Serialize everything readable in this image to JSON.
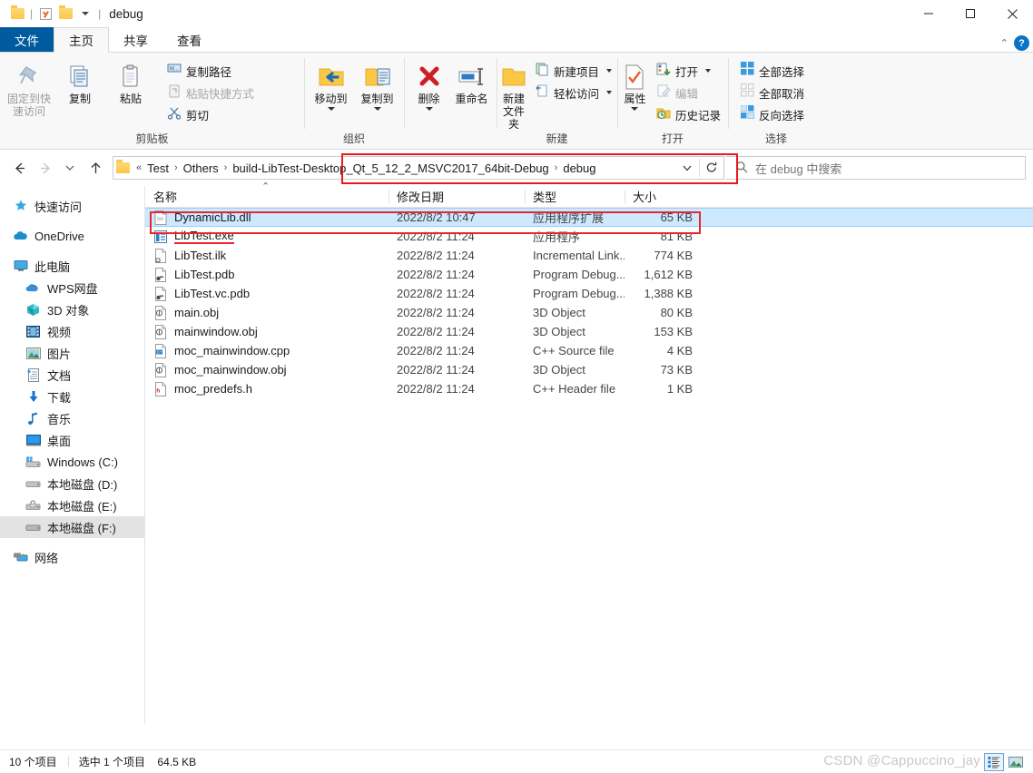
{
  "window": {
    "title": "debug",
    "quick_access": [
      "folder-icon",
      "properties-check-icon",
      "new-folder-icon",
      "customize-chevron-icon"
    ],
    "controls": {
      "minimize": "minimize-icon",
      "maximize": "maximize-icon",
      "close": "close-icon"
    }
  },
  "tabs": [
    {
      "label": "文件",
      "name": "tab-file"
    },
    {
      "label": "主页",
      "name": "tab-home"
    },
    {
      "label": "共享",
      "name": "tab-share"
    },
    {
      "label": "查看",
      "name": "tab-view"
    }
  ],
  "ribbon": {
    "help_glyph": "?",
    "collapse_glyph": "⌃",
    "groups": [
      {
        "title": "剪贴板",
        "big": [
          {
            "label_line1": "固定到快",
            "label_line2": "速访问",
            "icon": "pin-icon",
            "dim": true
          },
          {
            "label_line1": "复制",
            "label_line2": "",
            "icon": "copy-icon",
            "dim": false
          },
          {
            "label_line1": "粘贴",
            "label_line2": "",
            "icon": "paste-icon",
            "dim": false
          }
        ],
        "small": [
          {
            "label": "复制路径",
            "icon": "copy-path-icon",
            "dim": false
          },
          {
            "label": "粘贴快捷方式",
            "icon": "paste-shortcut-icon",
            "dim": true
          },
          {
            "label": "剪切",
            "icon": "scissors-icon",
            "dim": false
          }
        ]
      },
      {
        "title": "组织",
        "big": [
          {
            "label_line1": "移动到",
            "label_line2": "",
            "icon": "move-to-icon",
            "dropdown": true
          },
          {
            "label_line1": "复制到",
            "label_line2": "",
            "icon": "copy-to-icon",
            "dropdown": true
          },
          {
            "label_line1": "删除",
            "label_line2": "",
            "icon": "delete-icon",
            "dropdown": true
          },
          {
            "label_line1": "重命名",
            "label_line2": "",
            "icon": "rename-icon",
            "dropdown": false
          }
        ]
      },
      {
        "title": "新建",
        "big": [
          {
            "label_line1": "新建",
            "label_line2": "文件夹",
            "icon": "new-folder-icon"
          }
        ],
        "small": [
          {
            "label": "新建项目",
            "icon": "new-item-icon",
            "dropdown": true
          },
          {
            "label": "轻松访问",
            "icon": "easy-access-icon",
            "dropdown": true
          }
        ]
      },
      {
        "title": "打开",
        "big": [
          {
            "label_line1": "属性",
            "label_line2": "",
            "icon": "properties-icon",
            "dropdown": true
          }
        ],
        "small": [
          {
            "label": "打开",
            "icon": "open-icon",
            "dropdown": true
          },
          {
            "label": "编辑",
            "icon": "edit-icon",
            "dim": true
          },
          {
            "label": "历史记录",
            "icon": "history-icon"
          }
        ]
      },
      {
        "title": "选择",
        "small": [
          {
            "label": "全部选择",
            "icon": "select-all-icon"
          },
          {
            "label": "全部取消",
            "icon": "select-none-icon"
          },
          {
            "label": "反向选择",
            "icon": "invert-selection-icon"
          }
        ]
      }
    ]
  },
  "addressbar": {
    "back": "back-arrow-icon",
    "forward": "forward-arrow-icon",
    "recent": "recent-chevron-icon",
    "up": "up-arrow-icon",
    "folder_icon": "folder-icon",
    "crumb_prefix": "«",
    "crumbs": [
      "Test",
      "Others",
      "build-LibTest-Desktop_Qt_5_12_2_MSVC2017_64bit-Debug",
      "debug"
    ],
    "separator": "›",
    "dropdown": "chevron-down-icon",
    "refresh": "refresh-icon",
    "highlight_color": "#e81b1b"
  },
  "search": {
    "placeholder": "在 debug 中搜索",
    "icon": "search-icon"
  },
  "navpane": {
    "groups": [
      {
        "items": [
          {
            "label": "快速访问",
            "icon": "star-pin-icon",
            "indent": false,
            "selected": false
          }
        ]
      },
      {
        "items": [
          {
            "label": "OneDrive",
            "icon": "cloud-icon",
            "indent": false,
            "selected": false
          }
        ]
      },
      {
        "items": [
          {
            "label": "此电脑",
            "icon": "monitor-icon",
            "indent": false,
            "selected": false
          },
          {
            "label": "WPS网盘",
            "icon": "wps-cloud-icon",
            "indent": true,
            "selected": false
          },
          {
            "label": "3D 对象",
            "icon": "3d-object-icon",
            "indent": true,
            "selected": false
          },
          {
            "label": "视频",
            "icon": "video-icon",
            "indent": true,
            "selected": false
          },
          {
            "label": "图片",
            "icon": "pictures-icon",
            "indent": true,
            "selected": false
          },
          {
            "label": "文档",
            "icon": "documents-icon",
            "indent": true,
            "selected": false
          },
          {
            "label": "下载",
            "icon": "downloads-icon",
            "indent": true,
            "selected": false
          },
          {
            "label": "音乐",
            "icon": "music-icon",
            "indent": true,
            "selected": false
          },
          {
            "label": "桌面",
            "icon": "desktop-icon",
            "indent": true,
            "selected": false
          },
          {
            "label": "Windows (C:)",
            "icon": "system-drive-icon",
            "indent": true,
            "selected": false
          },
          {
            "label": "本地磁盘 (D:)",
            "icon": "drive-icon",
            "indent": true,
            "selected": false
          },
          {
            "label": "本地磁盘 (E:)",
            "icon": "locked-drive-icon",
            "indent": true,
            "selected": false
          },
          {
            "label": "本地磁盘 (F:)",
            "icon": "drive-icon",
            "indent": true,
            "selected": true
          }
        ]
      },
      {
        "items": [
          {
            "label": "网络",
            "icon": "network-icon",
            "indent": false,
            "selected": false
          }
        ]
      }
    ]
  },
  "filelist": {
    "columns": [
      {
        "label": "名称",
        "key": "name"
      },
      {
        "label": "修改日期",
        "key": "date"
      },
      {
        "label": "类型",
        "key": "type"
      },
      {
        "label": "大小",
        "key": "size"
      }
    ],
    "sort_indicator": "⌃",
    "rows": [
      {
        "name": "DynamicLib.dll",
        "date": "2022/8/2 10:47",
        "type": "应用程序扩展",
        "size": "65 KB",
        "icon": "dll-icon",
        "selected": true,
        "underline": false
      },
      {
        "name": "LibTest.exe",
        "date": "2022/8/2 11:24",
        "type": "应用程序",
        "size": "81 KB",
        "icon": "exe-icon",
        "selected": false,
        "underline": true
      },
      {
        "name": "LibTest.ilk",
        "date": "2022/8/2 11:24",
        "type": "Incremental Link...",
        "size": "774 KB",
        "icon": "ilk-icon",
        "selected": false,
        "underline": false
      },
      {
        "name": "LibTest.pdb",
        "date": "2022/8/2 11:24",
        "type": "Program Debug...",
        "size": "1,612 KB",
        "icon": "pdb-icon",
        "selected": false,
        "underline": false
      },
      {
        "name": "LibTest.vc.pdb",
        "date": "2022/8/2 11:24",
        "type": "Program Debug...",
        "size": "1,388 KB",
        "icon": "pdb-icon",
        "selected": false,
        "underline": false
      },
      {
        "name": "main.obj",
        "date": "2022/8/2 11:24",
        "type": "3D Object",
        "size": "80 KB",
        "icon": "obj-icon",
        "selected": false,
        "underline": false
      },
      {
        "name": "mainwindow.obj",
        "date": "2022/8/2 11:24",
        "type": "3D Object",
        "size": "153 KB",
        "icon": "obj-icon",
        "selected": false,
        "underline": false
      },
      {
        "name": "moc_mainwindow.cpp",
        "date": "2022/8/2 11:24",
        "type": "C++ Source file",
        "size": "4 KB",
        "icon": "cpp-icon",
        "selected": false,
        "underline": false
      },
      {
        "name": "moc_mainwindow.obj",
        "date": "2022/8/2 11:24",
        "type": "3D Object",
        "size": "73 KB",
        "icon": "obj-icon",
        "selected": false,
        "underline": false
      },
      {
        "name": "moc_predefs.h",
        "date": "2022/8/2 11:24",
        "type": "C++ Header file",
        "size": "1 KB",
        "icon": "header-icon",
        "selected": false,
        "underline": false
      }
    ]
  },
  "statusbar": {
    "item_count": "10 个项目",
    "selection": "选中 1 个项目",
    "selection_size": "64.5 KB",
    "view_details": "details-view-icon",
    "view_large": "large-icons-view-icon"
  },
  "watermark": "CSDN @Cappuccino_jay"
}
